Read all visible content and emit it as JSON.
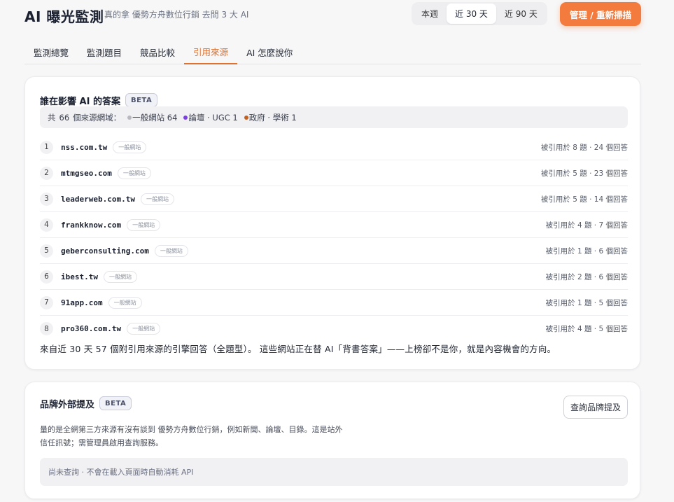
{
  "header": {
    "title": "AI 曝光監測",
    "subtitle": "真的拿 優勢方舟數位行銷 去問 3 大 AI",
    "ranges": [
      "本週",
      "近 30 天",
      "近 90 天"
    ],
    "active_range": "近 30 天",
    "primary_button": "管理 / 重新掃描"
  },
  "tabs": [
    {
      "label": "監測總覽"
    },
    {
      "label": "監測題目"
    },
    {
      "label": "競品比較"
    },
    {
      "label": "引用來源"
    },
    {
      "label": "AI 怎麼說你"
    }
  ],
  "active_tab": "引用來源",
  "sources_card": {
    "title": "誰在影響 AI 的答案",
    "badge": "BETA",
    "summary": {
      "prefix": "共",
      "count": "66",
      "suffix": "個來源網域：",
      "categories": [
        {
          "label": "一般網站 64",
          "color": "#b8b9bf"
        },
        {
          "label": "論壇 · UGC 1",
          "color": "#7b3fe0"
        },
        {
          "label": "政府 · 學術 1",
          "color": "#c2611f"
        }
      ]
    },
    "rows": [
      {
        "rank": "1",
        "domain": "nss.com.tw",
        "tag": "一般網站",
        "cited": "被引用於 8 題 · 24 個回答"
      },
      {
        "rank": "2",
        "domain": "mtmgseo.com",
        "tag": "一般網站",
        "cited": "被引用於 5 題 · 23 個回答"
      },
      {
        "rank": "3",
        "domain": "leaderweb.com.tw",
        "tag": "一般網站",
        "cited": "被引用於 5 題 · 14 個回答"
      },
      {
        "rank": "4",
        "domain": "frankknow.com",
        "tag": "一般網站",
        "cited": "被引用於 4 題 · 7 個回答"
      },
      {
        "rank": "5",
        "domain": "geberconsulting.com",
        "tag": "一般網站",
        "cited": "被引用於 1 題 · 6 個回答"
      },
      {
        "rank": "6",
        "domain": "ibest.tw",
        "tag": "一般網站",
        "cited": "被引用於 2 題 · 6 個回答"
      },
      {
        "rank": "7",
        "domain": "91app.com",
        "tag": "一般網站",
        "cited": "被引用於 1 題 · 5 個回答"
      },
      {
        "rank": "8",
        "domain": "pro360.com.tw",
        "tag": "一般網站",
        "cited": "被引用於 4 題 · 5 個回答"
      }
    ],
    "footnote": "來自近 30 天 57 個附引用來源的引擎回答（全題型）。 這些網站正在替 AI「背書答案」——上榜卻不是你，就是內容機會的方向。"
  },
  "mentions_card": {
    "title": "品牌外部提及",
    "badge": "BETA",
    "button": "查詢品牌提及",
    "desc_line1": "量的是全網第三方來源有沒有談到 優勢方舟數位行銷，例如新聞、論壇、目錄。這是站外",
    "desc_line2": "信任訊號；需管理員啟用查詢服務。",
    "empty_text": "尚未查詢 · 不會在載入頁面時自動消耗 API"
  }
}
